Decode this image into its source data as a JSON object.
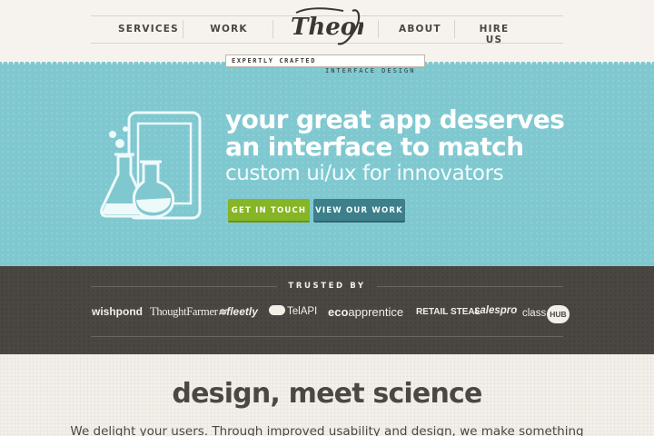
{
  "nav": {
    "services": "SERVICES",
    "work": "WORK",
    "about": "ABOUT",
    "hire_us": "HIRE US"
  },
  "logo": {
    "text": "Theory"
  },
  "tagline": {
    "line1": "EXPERTLY CRAFTED",
    "line2": "INTERFACE DESIGN"
  },
  "hero": {
    "headline_1": "your great app deserves",
    "headline_2": "an interface to match",
    "subhead": "custom ui/ux for innovators",
    "cta_primary": "GET IN TOUCH",
    "cta_secondary": "VIEW OUR WORK"
  },
  "trusted": {
    "title": "TRUSTED BY",
    "brands": {
      "wishpond": "wishpond",
      "thoughtfarmer": "ThoughtFarmer",
      "fleetly": "fleetly",
      "telapi": "TelAPI",
      "ecoapprentice_a": "eco",
      "ecoapprentice_b": "apprentice",
      "retailsteal": "RETAIL STEAL",
      "salespro": "salespro",
      "classhub_a": "class",
      "classhub_b": "HUB"
    }
  },
  "section2": {
    "title": "design, meet science",
    "body": "We delight your users. Through improved usability and design, we make something"
  },
  "colors": {
    "hero_bg": "#7fc8d0",
    "accent_green": "#86b525",
    "accent_teal": "#3d7f8a",
    "dark_band": "#4a4642",
    "text_dark": "#4b4742"
  }
}
